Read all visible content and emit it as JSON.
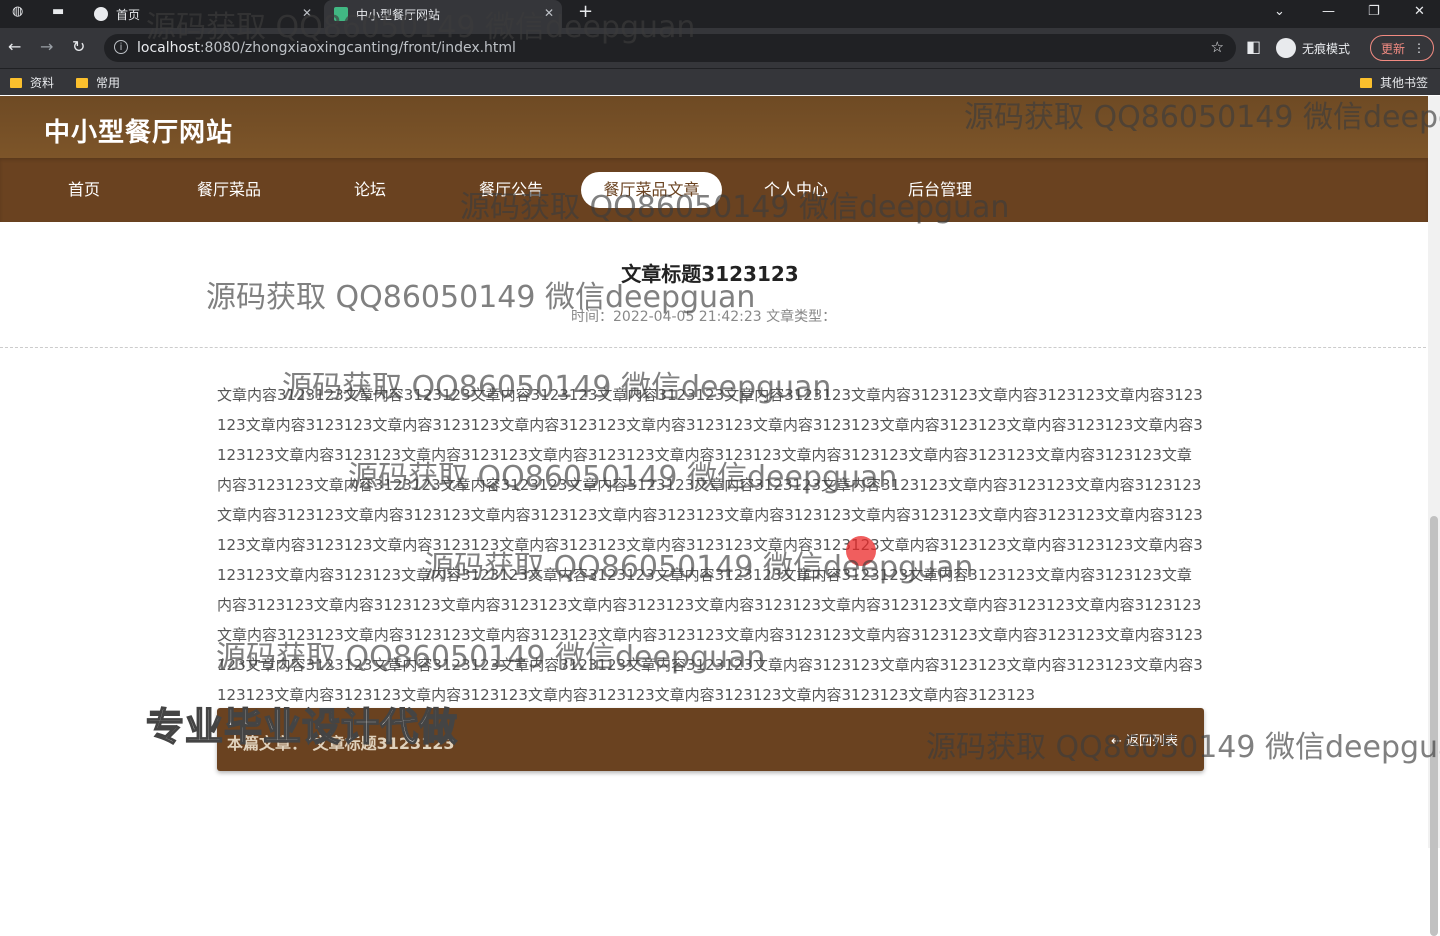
{
  "browser": {
    "tabs": [
      {
        "label": "首页",
        "active": false
      },
      {
        "label": "中小型餐厅网站",
        "active": true
      }
    ],
    "new_tab": "+",
    "url_host": "localhost",
    "url_rest": ":8080/zhongxiaoxingcanting/front/index.html",
    "incognito_label": "无痕模式",
    "update_label": "更新",
    "bookmarks": [
      "资料",
      "常用"
    ],
    "other_bookmarks": "其他书签"
  },
  "site": {
    "title": "中小型餐厅网站",
    "nav": [
      "首页",
      "餐厅菜品",
      "论坛",
      "餐厅公告",
      "餐厅菜品文章",
      "个人中心",
      "后台管理"
    ],
    "active_nav": "餐厅菜品文章"
  },
  "article": {
    "title": "文章标题3123123",
    "meta": "时间：2022-04-05 21:42:23 文章类型：",
    "content": "文章内容3123123文章内容3123123文章内容3123123文章内容3123123文章内容3123123文章内容3123123文章内容3123123文章内容3123123文章内容3123123文章内容3123123文章内容3123123文章内容3123123文章内容3123123文章内容3123123文章内容3123123文章内容3123123文章内容3123123文章内容3123123文章内容3123123文章内容3123123文章内容3123123文章内容3123123文章内容3123123文章内容3123123文章内容3123123文章内容3123123文章内容3123123文章内容3123123文章内容3123123文章内容3123123文章内容3123123文章内容3123123文章内容3123123文章内容3123123文章内容3123123文章内容3123123文章内容3123123文章内容3123123文章内容3123123文章内容3123123文章内容3123123文章内容3123123文章内容3123123文章内容3123123文章内容3123123文章内容3123123文章内容3123123文章内容3123123文章内容3123123文章内容3123123文章内容3123123文章内容3123123文章内容3123123文章内容3123123文章内容3123123文章内容3123123文章内容3123123文章内容3123123文章内容3123123文章内容3123123文章内容3123123文章内容3123123文章内容3123123文章内容3123123文章内容3123123文章内容3123123文章内容3123123文章内容3123123文章内容3123123文章内容3123123文章内容3123123文章内容3123123文章内容3123123文章内容3123123文章内容3123123文章内容3123123文章内容3123123文章内容3123123文章内容3123123文章内容3123123文章内容3123123文章内容3123123文章内容3123123文章内容3123123",
    "this_article": "本篇文章：  文章标题3123123",
    "back_label": "返回列表"
  },
  "overlay": {
    "watermark": "源码获取 QQ86050149 微信deepguan",
    "stamp": "专业毕业设计代做"
  },
  "colors": {
    "header": "#7d5529",
    "nav": "#6a4220",
    "bottom_bar": "#6a4220"
  }
}
